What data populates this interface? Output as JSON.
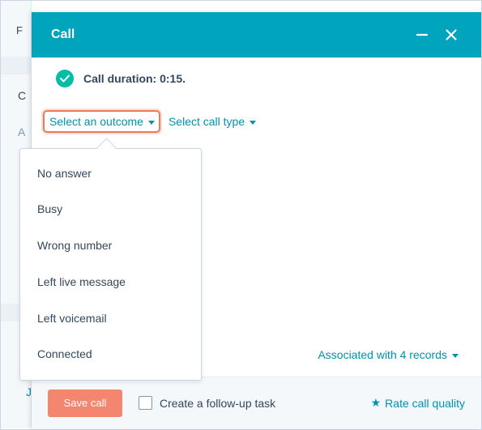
{
  "background": {
    "letters": [
      "F",
      "C",
      "A",
      "J"
    ]
  },
  "panel": {
    "title": "Call",
    "minimize_icon": "minus-icon",
    "close_icon": "close-icon",
    "duration": {
      "icon": "check-circle-icon",
      "text": "Call duration: 0:15."
    },
    "outcome_label": "Select an outcome",
    "call_type_label": "Select call type",
    "associated_label": "Associated with 4 records",
    "footer": {
      "save_label": "Save call",
      "task_label": "Create a follow-up task",
      "task_checked": false,
      "rate_icon": "star-icon",
      "rate_label": "Rate call quality"
    }
  },
  "dropdown": {
    "items": [
      {
        "label": "No answer"
      },
      {
        "label": "Busy"
      },
      {
        "label": "Wrong number"
      },
      {
        "label": "Left live message"
      },
      {
        "label": "Left voicemail"
      },
      {
        "label": "Connected"
      }
    ]
  },
  "colors": {
    "header": "#00a4bd",
    "link": "#0091ae",
    "highlight": "#ea7a5e",
    "save_button": "#f2866f",
    "success": "#00bda5"
  }
}
